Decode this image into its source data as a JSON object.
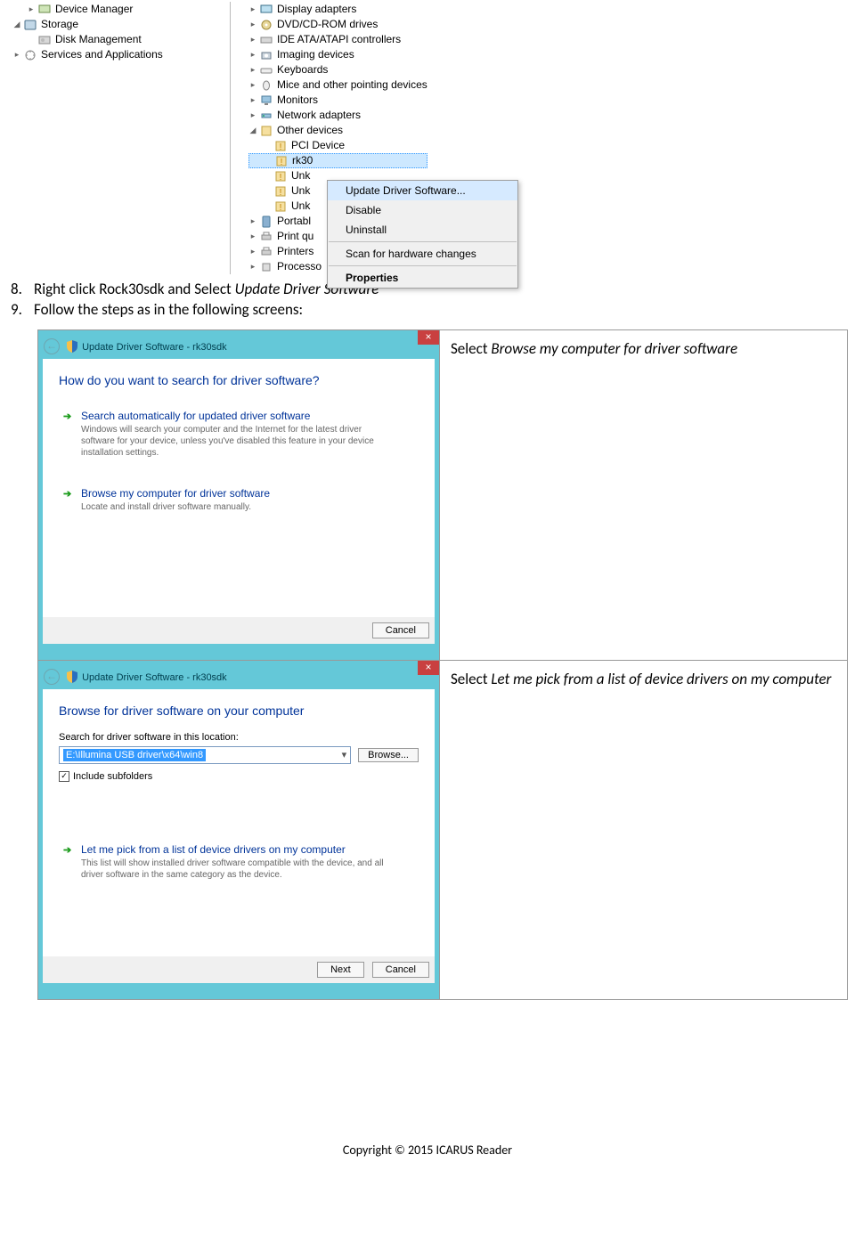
{
  "dm_left": [
    {
      "expander": "▸",
      "label": "Device Manager",
      "indent": 1,
      "icon": "monitor-card-icon"
    },
    {
      "expander": "◢",
      "label": "Storage",
      "indent": 0,
      "icon": "storage-icon"
    },
    {
      "expander": "",
      "label": "Disk Management",
      "indent": 1,
      "icon": "disk-icon"
    },
    {
      "expander": "▸",
      "label": "Services and Applications",
      "indent": 0,
      "icon": "services-icon"
    }
  ],
  "dm_right": [
    {
      "expander": "▸",
      "label": "Display adapters",
      "icon": "display-icon",
      "indent": 0
    },
    {
      "expander": "▸",
      "label": "DVD/CD-ROM drives",
      "icon": "dvd-icon",
      "indent": 0
    },
    {
      "expander": "▸",
      "label": "IDE ATA/ATAPI controllers",
      "icon": "ide-icon",
      "indent": 0
    },
    {
      "expander": "▸",
      "label": "Imaging devices",
      "icon": "camera-icon",
      "indent": 0
    },
    {
      "expander": "▸",
      "label": "Keyboards",
      "icon": "keyboard-icon",
      "indent": 0
    },
    {
      "expander": "▸",
      "label": "Mice and other pointing devices",
      "icon": "mouse-icon",
      "indent": 0
    },
    {
      "expander": "▸",
      "label": "Monitors",
      "icon": "monitor-icon",
      "indent": 0
    },
    {
      "expander": "▸",
      "label": "Network adapters",
      "icon": "network-icon",
      "indent": 0
    },
    {
      "expander": "◢",
      "label": "Other devices",
      "icon": "other-icon",
      "indent": 0
    },
    {
      "expander": "",
      "label": "PCI Device",
      "icon": "warn-icon",
      "indent": 1
    },
    {
      "expander": "",
      "label": "rk30",
      "icon": "warn-icon",
      "indent": 1,
      "selected": true
    },
    {
      "expander": "",
      "label": "Unk",
      "icon": "warn-icon",
      "indent": 1
    },
    {
      "expander": "",
      "label": "Unk",
      "icon": "warn-icon",
      "indent": 1
    },
    {
      "expander": "",
      "label": "Unk",
      "icon": "warn-icon",
      "indent": 1
    },
    {
      "expander": "▸",
      "label": "Portabl",
      "icon": "portable-icon",
      "indent": 0
    },
    {
      "expander": "▸",
      "label": "Print qu",
      "icon": "printer-icon",
      "indent": 0
    },
    {
      "expander": "▸",
      "label": "Printers",
      "icon": "printer-icon",
      "indent": 0
    },
    {
      "expander": "▸",
      "label": "Processo",
      "icon": "cpu-icon",
      "indent": 0
    }
  ],
  "ctx_menu": {
    "items": [
      {
        "label": "Update Driver Software...",
        "selected": true
      },
      {
        "label": "Disable"
      },
      {
        "label": "Uninstall"
      },
      {
        "sep": true
      },
      {
        "label": "Scan for hardware changes"
      },
      {
        "sep": true
      },
      {
        "label": "Properties",
        "bold": true
      }
    ]
  },
  "instr": {
    "n8": "8.",
    "t8a": "Right click Rock30sdk and Select ",
    "t8b": "Update Driver Software",
    "n9": "9.",
    "t9": "Follow the steps as in the following screens:"
  },
  "win1": {
    "title": "Update Driver Software - rk30sdk",
    "heading": "How do you want to search for driver software?",
    "opt1_t": "Search automatically for updated driver software",
    "opt1_d": "Windows will search your computer and the Internet for the latest driver software for your device, unless you've disabled this feature in your device installation settings.",
    "opt2_t": "Browse my computer for driver software",
    "opt2_d": "Locate and install driver software manually.",
    "cancel": "Cancel"
  },
  "cap1a": "Select ",
  "cap1b": "Browse my computer for driver software",
  "win2": {
    "title": "Update Driver Software - rk30sdk",
    "heading": "Browse for driver software on your computer",
    "field_label": "Search for driver software in this location:",
    "path": "E:\\Illumina USB driver\\x64\\win8",
    "browse": "Browse...",
    "include": "Include subfolders",
    "opt_t": "Let me pick from a list of device drivers on my computer",
    "opt_d": "This list will show installed driver software compatible with the device, and all driver software in the same category as the device.",
    "next": "Next",
    "cancel": "Cancel"
  },
  "cap2a": "Select ",
  "cap2b": "Let me pick from a list of device drivers on my computer",
  "footer": "Copyright © 2015 ICARUS Reader"
}
